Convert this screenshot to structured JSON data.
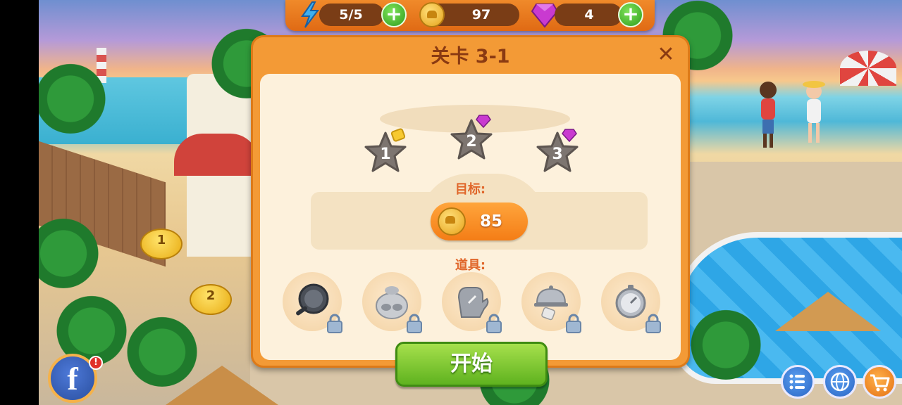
{
  "resources": {
    "energy": "5/5",
    "coins": "97",
    "gems": "4",
    "plus_label": "+"
  },
  "dialog": {
    "title": "关卡 3-1",
    "close_label": "✕",
    "stars": [
      "1",
      "2",
      "3"
    ],
    "goal_label": "目标:",
    "goal_value": "85",
    "items_label": "道具:",
    "items": [
      "frying-pan-icon",
      "flour-bag-icon",
      "oven-mitt-icon",
      "serving-cloche-icon",
      "timer-icon"
    ],
    "start_label": "开始"
  },
  "map": {
    "nodes": [
      "1",
      "2"
    ]
  },
  "social": {
    "facebook_label": "f",
    "alert_label": "!"
  },
  "colors": {
    "dialog_frame": "#f39a36",
    "dialog_inner": "#fdf1dc",
    "start_green": "#5fb21f",
    "title_brown": "#8a3a12",
    "label_orange": "#e0662a"
  }
}
